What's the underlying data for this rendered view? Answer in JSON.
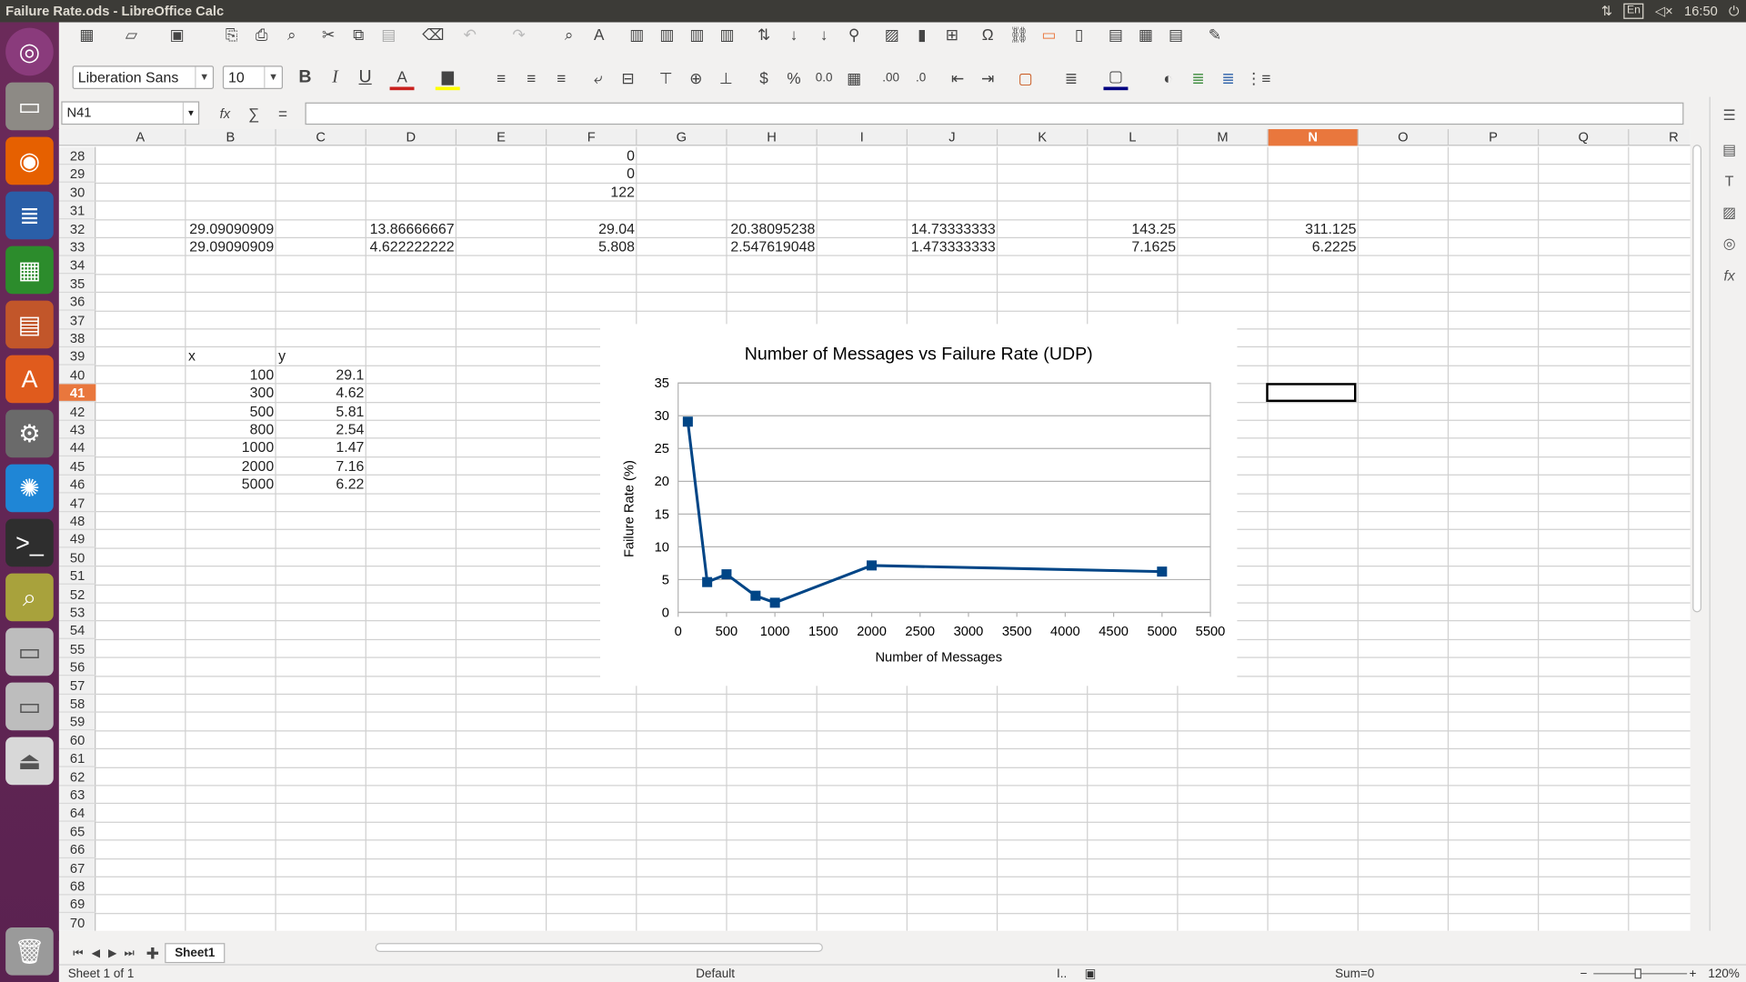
{
  "window": {
    "title": "Failure Rate.ods - LibreOffice Calc",
    "clock": "16:50",
    "lang": "En"
  },
  "toolbar": {
    "font_name": "Liberation Sans",
    "font_size": "10"
  },
  "formula_bar": {
    "cell_ref": "N41",
    "content": ""
  },
  "columns": [
    "A",
    "B",
    "C",
    "D",
    "E",
    "F",
    "G",
    "H",
    "I",
    "J",
    "K",
    "L",
    "M",
    "N",
    "O",
    "P",
    "Q",
    "R"
  ],
  "selected_column": "N",
  "selected_row": "41",
  "rows": [
    "28",
    "29",
    "30",
    "31",
    "32",
    "33",
    "34",
    "35",
    "36",
    "37",
    "38",
    "39",
    "40",
    "41",
    "42",
    "43",
    "44",
    "45",
    "46",
    "47",
    "48",
    "49",
    "50",
    "51",
    "52",
    "53",
    "54",
    "55",
    "56",
    "57",
    "58",
    "59",
    "60",
    "61",
    "62",
    "63",
    "64",
    "65",
    "66",
    "67",
    "68",
    "69",
    "70"
  ],
  "cells": {
    "F28": "0",
    "F29": "0",
    "F30": "122",
    "B32": "29.09090909",
    "D32": "13.86666667",
    "F32": "29.04",
    "H32": "20.38095238",
    "J32": "14.73333333",
    "L32": "143.25",
    "N32": "311.125",
    "B33": "29.09090909",
    "D33": "4.622222222",
    "F33": "5.808",
    "H33": "2.547619048",
    "J33": "1.473333333",
    "L33": "7.1625",
    "N33": "6.2225",
    "B39": "x",
    "C39": "y",
    "B40": "100",
    "C40": "29.1",
    "B41": "300",
    "C41": "4.62",
    "B42": "500",
    "C42": "5.81",
    "B43": "800",
    "C43": "2.54",
    "B44": "1000",
    "C44": "1.47",
    "B45": "2000",
    "C45": "7.16",
    "B46": "5000",
    "C46": "6.22"
  },
  "chart_data": {
    "type": "line",
    "title": "Number of Messages vs Failure Rate (UDP)",
    "xlabel": "Number of Messages",
    "ylabel": "Failure Rate (%)",
    "x": [
      100,
      300,
      500,
      800,
      1000,
      2000,
      5000
    ],
    "series": [
      {
        "values": [
          29.1,
          4.62,
          5.81,
          2.54,
          1.47,
          7.16,
          6.22
        ]
      }
    ],
    "xlim": [
      0,
      5500
    ],
    "ylim": [
      0,
      35
    ],
    "xticks": [
      "0",
      "500",
      "1000",
      "1500",
      "2000",
      "2500",
      "3000",
      "3500",
      "4000",
      "4500",
      "5000",
      "5500"
    ],
    "yticks": [
      "0",
      "5",
      "10",
      "15",
      "20",
      "25",
      "30",
      "35"
    ],
    "grid": true,
    "legend": "none",
    "color": "#004586"
  },
  "tabs": {
    "sheet1": "Sheet1"
  },
  "status": {
    "sheet_info": "Sheet 1 of 1",
    "page_style": "Default",
    "sum": "Sum=0",
    "zoom": "120%"
  }
}
